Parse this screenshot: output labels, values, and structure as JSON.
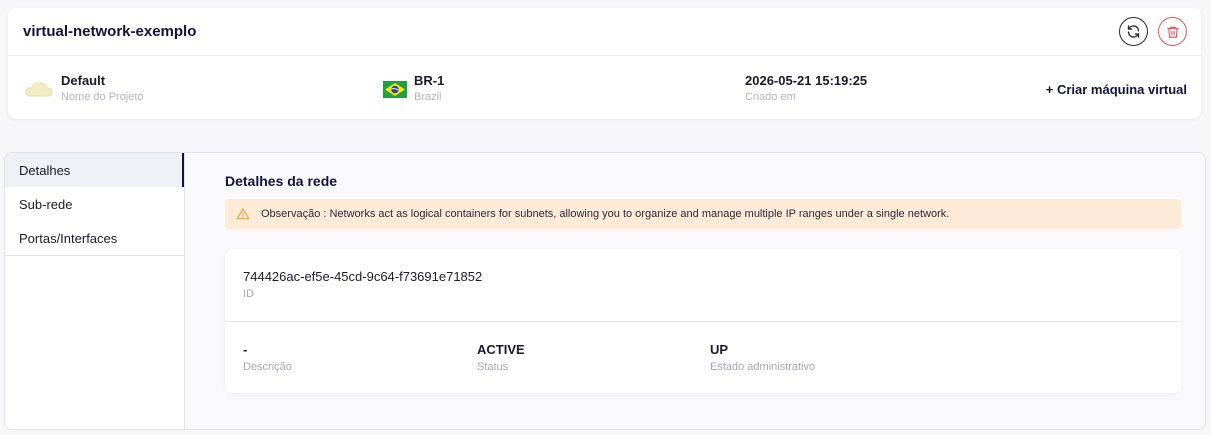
{
  "header": {
    "title": "virtual-network-exemplo",
    "project": {
      "value": "Default",
      "label": "Nome do Projeto"
    },
    "region": {
      "value": "BR-1",
      "label": "Brazil"
    },
    "created": {
      "value": "2026-05-21 15:19:25",
      "label": "Criado em"
    },
    "create_vm_label": "+ Criar máquina virtual",
    "icons": {
      "refresh": "refresh-icon",
      "delete": "trash-icon",
      "project": "cloud-icon",
      "flag": "brazil-flag-icon"
    }
  },
  "sidebar": {
    "items": [
      {
        "label": "Detalhes",
        "active": true
      },
      {
        "label": "Sub-rede",
        "active": false
      },
      {
        "label": "Portas/Interfaces",
        "active": false
      }
    ]
  },
  "main": {
    "section_title": "Detalhes da rede",
    "alert": "Observação : Networks act as logical containers for subnets, allowing you to organize and manage multiple IP ranges under a single network.",
    "id": {
      "value": "744426ac-ef5e-45cd-9c64-f73691e71852",
      "label": "ID"
    },
    "description": {
      "value": "-",
      "label": "Descrição"
    },
    "status": {
      "value": "ACTIVE",
      "label": "Status"
    },
    "admin_state": {
      "value": "UP",
      "label": "Estado administrativo"
    }
  },
  "colors": {
    "accent": "#14123a",
    "danger": "#e05a5a",
    "alert_bg": "#fdebd8",
    "alert_icon": "#e8a33d"
  }
}
